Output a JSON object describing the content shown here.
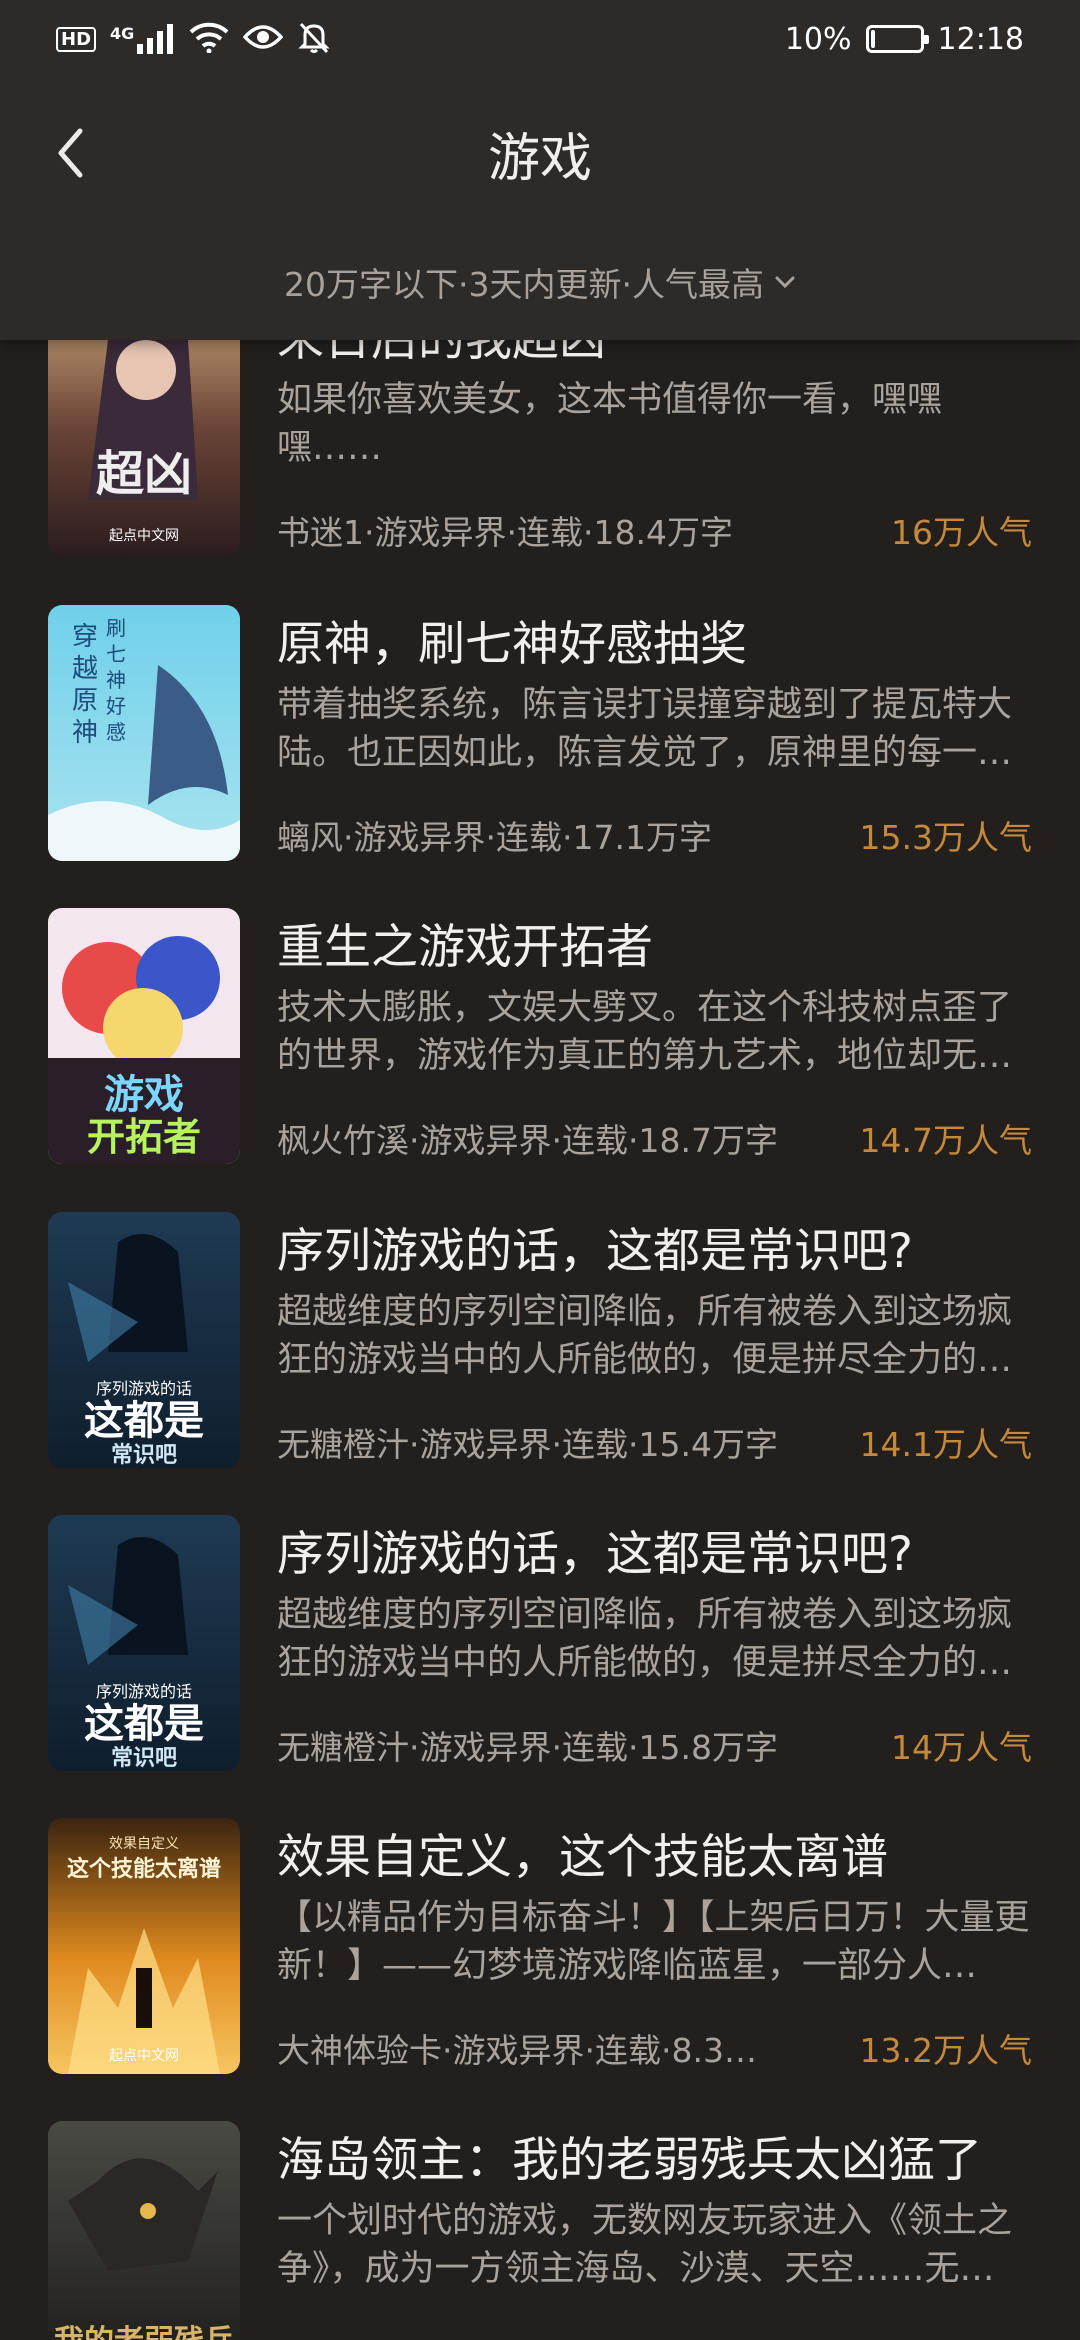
{
  "status_bar": {
    "network": "4G",
    "hd": "HD",
    "battery_percent": 10,
    "battery_text": "10%",
    "time": "12:18",
    "icons": [
      "hd-icon",
      "signal-icon",
      "wifi-icon",
      "eye-icon",
      "mute-bell-icon",
      "battery-icon"
    ]
  },
  "header": {
    "title": "游戏",
    "filter": "20万字以下·3天内更新·人气最高"
  },
  "colors": {
    "background": "#221f1d",
    "header": "#2e2a28",
    "popularity": "#c5893c"
  },
  "books": [
    {
      "title": "末日后的我超凶",
      "desc": "如果你喜欢美女，这本书值得你一看，嘿嘿嘿……",
      "meta": "书迷1·游戏异界·连载·18.4万字",
      "popularity": "16万人气"
    },
    {
      "title": "原神，刷七神好感抽奖",
      "desc": "带着抽奖系统，陈言误打误撞穿越到了提瓦特大陆。也正因如此，陈言发觉了，原神里的每一…",
      "meta": "螭风·游戏异界·连载·17.1万字",
      "popularity": "15.3万人气"
    },
    {
      "title": "重生之游戏开拓者",
      "desc": "技术大膨胀，文娱大劈叉。在这个科技树点歪了的世界，游戏作为真正的第九艺术，地位却无…",
      "meta": "枫火竹溪·游戏异界·连载·18.7万字",
      "popularity": "14.7万人气"
    },
    {
      "title": "序列游戏的话，这都是常识吧?",
      "desc": "超越维度的序列空间降临，所有被卷入到这场疯狂的游戏当中的人所能做的，便是拼尽全力的…",
      "meta": "无糖橙汁·游戏异界·连载·15.4万字",
      "popularity": "14.1万人气"
    },
    {
      "title": "序列游戏的话，这都是常识吧?",
      "desc": "超越维度的序列空间降临，所有被卷入到这场疯狂的游戏当中的人所能做的，便是拼尽全力的…",
      "meta": "无糖橙汁·游戏异界·连载·15.8万字",
      "popularity": "14万人气"
    },
    {
      "title": "效果自定义，这个技能太离谱",
      "desc": "【以精品作为目标奋斗！】【上架后日万！大量更新！】——幻梦境游戏降临蓝星，一部分人…",
      "meta": "大神体验卡·游戏异界·连载·8.3…",
      "popularity": "13.2万人气"
    },
    {
      "title": "海岛领主：我的老弱残兵太凶猛了",
      "desc": "一个划时代的游戏，无数网友玩家进入《领土之争》，成为一方领主海岛、沙漠、天空……无…",
      "meta": "",
      "popularity": ""
    }
  ]
}
